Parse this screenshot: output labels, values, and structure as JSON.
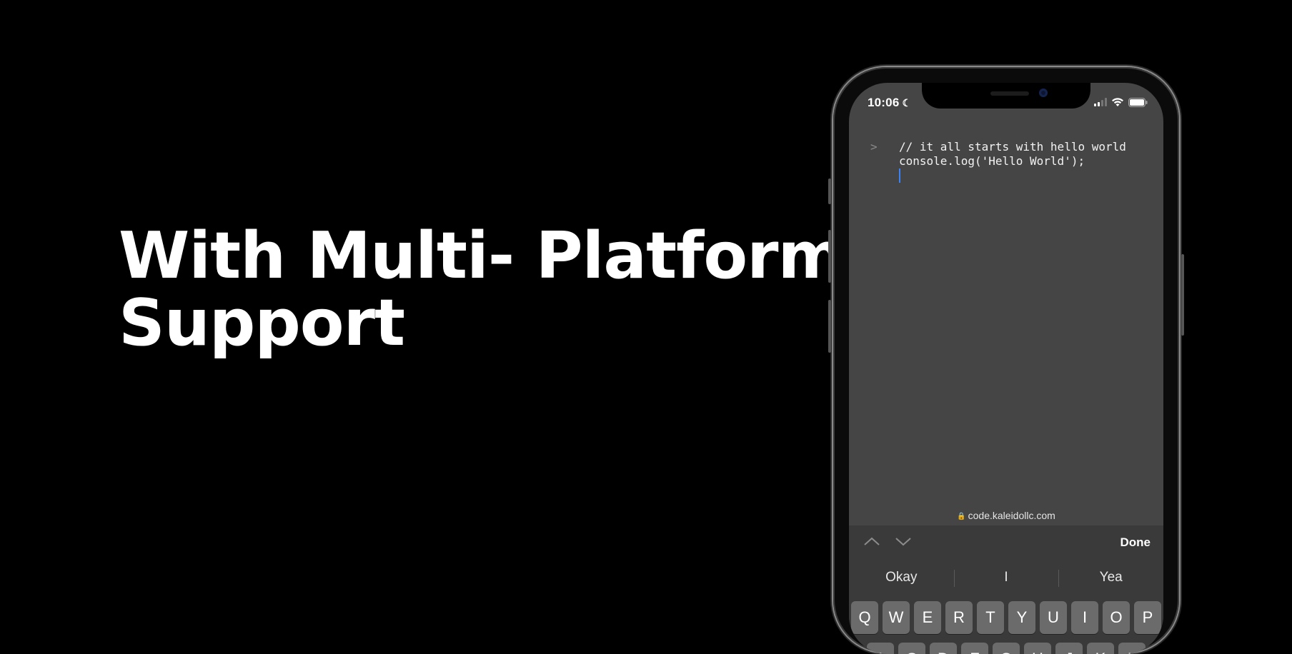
{
  "headline": {
    "line1": "With Multi- Platform",
    "line2": "Support"
  },
  "phone": {
    "status_bar": {
      "time": "10:06",
      "moon_icon": "moon-icon",
      "signal_icon": "cellular-signal-icon",
      "wifi_icon": "wifi-icon",
      "battery_icon": "battery-icon"
    },
    "editor": {
      "prompt": ">",
      "lines": [
        "// it all starts with hello world",
        "console.log('Hello World');"
      ]
    },
    "url_bar": {
      "lock_icon": "lock-icon",
      "domain": "code.kaleidollc.com"
    },
    "keyboard": {
      "prev_icon": "chevron-up-icon",
      "next_icon": "chevron-down-icon",
      "done_label": "Done",
      "suggestions": [
        "Okay",
        "I",
        "Yea"
      ],
      "row1": [
        "Q",
        "W",
        "E",
        "R",
        "T",
        "Y",
        "U",
        "I",
        "O",
        "P"
      ],
      "row2": [
        "A",
        "S",
        "D",
        "F",
        "G",
        "H",
        "J",
        "K",
        "L"
      ]
    }
  },
  "colors": {
    "background": "#000000",
    "screen": "#454545",
    "keyboard": "#3a3a3a",
    "key": "#6b6b6b",
    "cursor": "#3b82f6"
  }
}
